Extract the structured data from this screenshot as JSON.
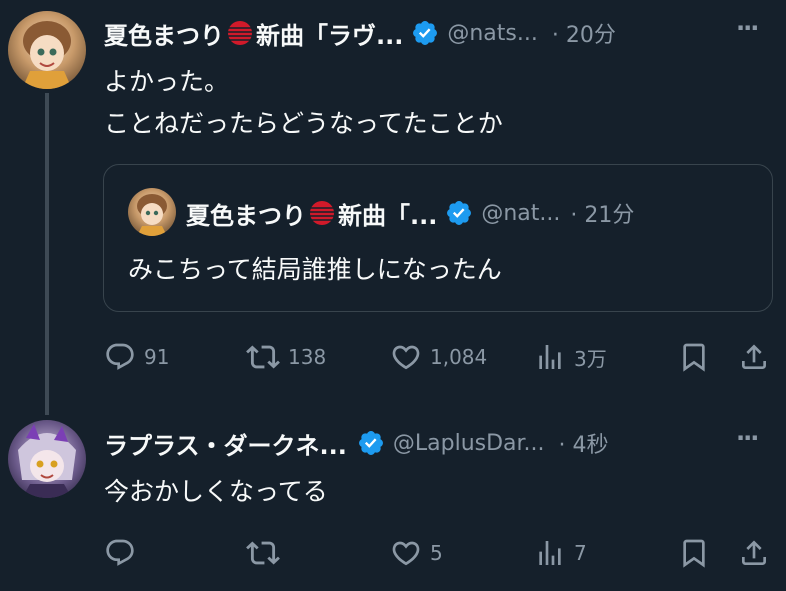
{
  "colors": {
    "background": "#15202b",
    "text_primary": "#f7f9f9",
    "text_secondary": "#8b98a5",
    "verified_blue": "#1d9bf0",
    "thread_line": "#3e4a55",
    "quote_border": "#38444d"
  },
  "tweets": [
    {
      "display_name": "夏色まつり",
      "name_suffix": "新曲「ラヴ...",
      "handle": "@nats...",
      "time": "· 20分",
      "more": "···",
      "text_lines": [
        "よかった。",
        "ことねだったらどうなってたことか"
      ],
      "quote": {
        "display_name": "夏色まつり",
        "name_suffix": "新曲「...",
        "handle": "@nat...",
        "time": "· 21分",
        "text": "みこちって結局誰推しになったん"
      },
      "actions": {
        "reply_count": "91",
        "retweet_count": "138",
        "like_count": "1,084",
        "view_count": "3万"
      }
    },
    {
      "display_name": "ラプラス・ダークネ...",
      "handle": "@LaplusDar...",
      "time": "· 4秒",
      "more": "···",
      "text": "今おかしくなってる",
      "actions": {
        "reply_count": "",
        "retweet_count": "",
        "like_count": "5",
        "view_count": "7"
      }
    }
  ],
  "icons": [
    "reply-icon",
    "retweet-icon",
    "like-icon",
    "views-icon",
    "bookmark-icon",
    "share-icon",
    "verified-badge-icon",
    "more-icon"
  ]
}
